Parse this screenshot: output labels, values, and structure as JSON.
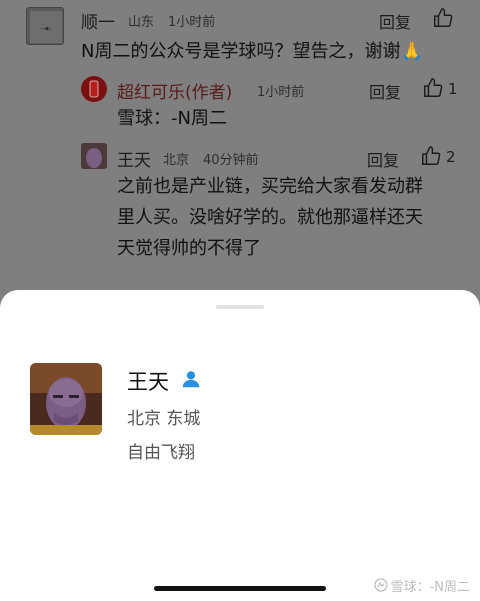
{
  "comments": [
    {
      "user": "顺一",
      "location": "山东",
      "time": "1小时前",
      "reply_label": "回复",
      "text": "N周二的公众号是学球吗？望告之，谢谢🙏"
    },
    {
      "user": "超红可乐(作者)",
      "location": "",
      "time": "1小时前",
      "reply_label": "回复",
      "likes": "1",
      "text": "雪球：-N周二"
    },
    {
      "user": "王天",
      "location": "北京",
      "time": "40分钟前",
      "reply_label": "回复",
      "likes": "2",
      "text_line1": "之前也是产业链，买完给大家看发动群",
      "text_line2": "里人买。没啥好学的。就他那逼样还天",
      "text_line3": "天觉得帅的不得了"
    }
  ],
  "profile_sheet": {
    "name": "王天",
    "location": "北京 东城",
    "bio": "自由飞翔",
    "icons": [
      "person-verified-icon"
    ]
  },
  "watermark": "雪球：-N周二",
  "colors": {
    "verified": "#2a8fe0",
    "overlay": "#7f7f7f"
  }
}
